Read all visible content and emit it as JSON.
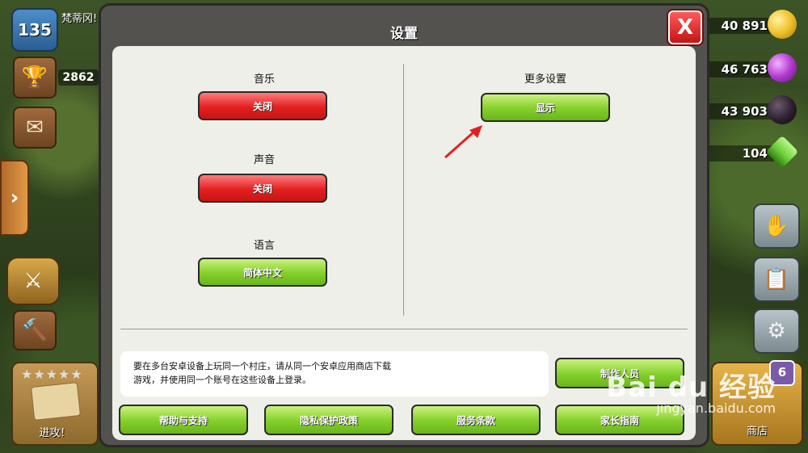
{
  "player": {
    "level": "135",
    "name": "梵蒂冈!",
    "trophies": "2862"
  },
  "side_tab_glyph": "›",
  "attack": {
    "label": "进攻！",
    "stars": "★★★★★"
  },
  "resources": [
    {
      "value": "40 891",
      "color": "#f0c22b"
    },
    {
      "value": "46 763",
      "color": "#b23bd1"
    },
    {
      "value": "43 903",
      "color": "#2b1f2e"
    },
    {
      "value": "104",
      "color": "#6dcf3a"
    }
  ],
  "shop": {
    "label": "商店",
    "badge": "6"
  },
  "dialog": {
    "title": "设置",
    "close_glyph": "X",
    "music": {
      "label": "音乐",
      "button": "关闭"
    },
    "sound": {
      "label": "声音",
      "button": "关闭"
    },
    "language": {
      "label": "语言",
      "button": "简体中文"
    },
    "more": {
      "label": "更多设置",
      "button": "显示"
    },
    "note_line1": "要在多台安卓设备上玩同一个村庄，请从同一个安卓应用商店下载",
    "note_line2": "游戏，并使用同一个账号在这些设备上登录。",
    "credits_button": "制作人员",
    "bottom_buttons": [
      "帮助与支持",
      "隐私保护政策",
      "服务条款",
      "家长指南"
    ]
  },
  "watermark": {
    "brand": "Bai du 经验",
    "url": "jingyan.baidu.com"
  },
  "colors": {
    "accent_red": "#e3201f",
    "accent_green": "#83cf2a",
    "arrow": "#e3201f"
  }
}
